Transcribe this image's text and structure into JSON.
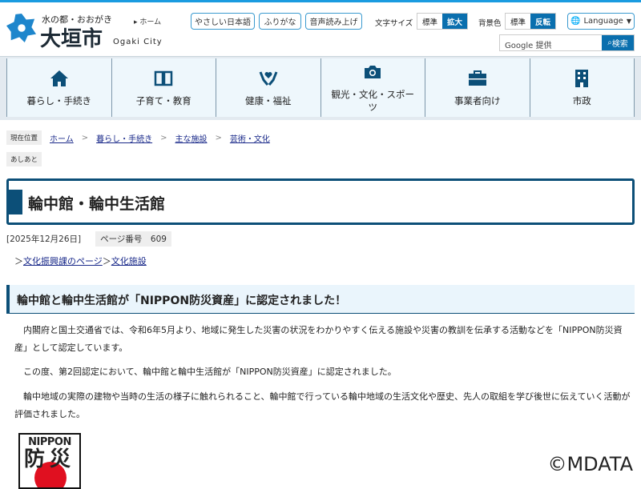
{
  "header": {
    "tagline": "水の都・おおがき",
    "city": "大垣市",
    "city_en": "Ogaki City",
    "home": "ホーム",
    "buttons": [
      "やさしい日本語",
      "ふりがな",
      "音声読み上げ"
    ],
    "font_size": {
      "label": "文字サイズ",
      "options": [
        "標準",
        "拡大"
      ]
    },
    "bg_color": {
      "label": "背景色",
      "options": [
        "標準",
        "反転"
      ]
    },
    "language": "Language",
    "search_placeholder": "Google 提供",
    "search_button": "検索"
  },
  "nav": [
    "暮らし・手続き",
    "子育て・教育",
    "健康・福祉",
    "観光・文化・スポーツ",
    "事業者向け",
    "市政"
  ],
  "breadcrumb": {
    "label": "現在位置",
    "items": [
      "ホーム",
      "暮らし・手続き",
      "主な施設",
      "芸術・文化"
    ],
    "sep": ">"
  },
  "ashiato": "あしあと",
  "title": "輪中館・輪中生活館",
  "date": "[2025年12月26日]",
  "page_no": "ページ番号　609",
  "links": {
    "prefix": "＞",
    "a": "文化振興課のページ",
    "b": "文化施設"
  },
  "section_title": "輪中館と輪中生活館が「NIPPON防災資産」に認定されました！",
  "paragraphs": [
    "内閣府と国土交通省では、令和6年5月より、地域に発生した災害の状況をわかりやすく伝える施設や災害の教訓を伝承する活動などを「NIPPON防災資産」として認定しています。",
    "この度、第2回認定において、輪中館と輪中生活館が「NIPPON防災資産」に認定されました。",
    "輪中地域の実際の建物や当時の生活の様子に触れられること、輪中館で行っている輪中地域の生活文化や歴史、先人の取組を学び後世に伝えていく活動が評価されました。"
  ],
  "logo": {
    "text": "NIPPON",
    "kanji": "防災"
  },
  "watermark": "©MDATA"
}
